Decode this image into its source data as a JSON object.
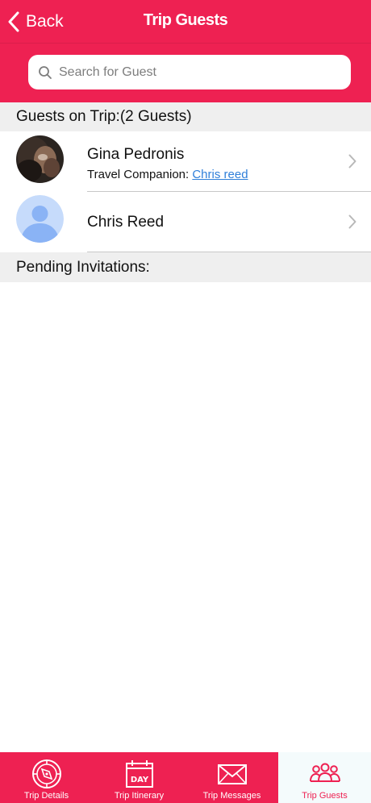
{
  "nav": {
    "back_label": "Back",
    "title": "Trip Guests"
  },
  "search": {
    "placeholder": "Search for Guest",
    "value": ""
  },
  "sections": {
    "guests_header": "Guests on Trip:(2 Guests)",
    "pending_header": "Pending Invitations:"
  },
  "guests": [
    {
      "name": "Gina Pedronis",
      "companion_label": "Travel Companion: ",
      "companion_name": "Chris reed",
      "avatar": "photo"
    },
    {
      "name": "Chris Reed",
      "avatar": "default-person-icon"
    }
  ],
  "tabs": [
    {
      "label": "Trip Details",
      "icon": "compass-icon",
      "active": false
    },
    {
      "label": "Trip Itinerary",
      "icon": "calendar-day-icon",
      "active": false
    },
    {
      "label": "Trip Messages",
      "icon": "envelope-icon",
      "active": false
    },
    {
      "label": "Trip Guests",
      "icon": "group-icon",
      "active": true
    }
  ],
  "colors": {
    "brand": "#ee2152",
    "section_bg": "#efefef",
    "link": "#2f7fd9",
    "active_tab_bg": "#f4fbfc"
  }
}
